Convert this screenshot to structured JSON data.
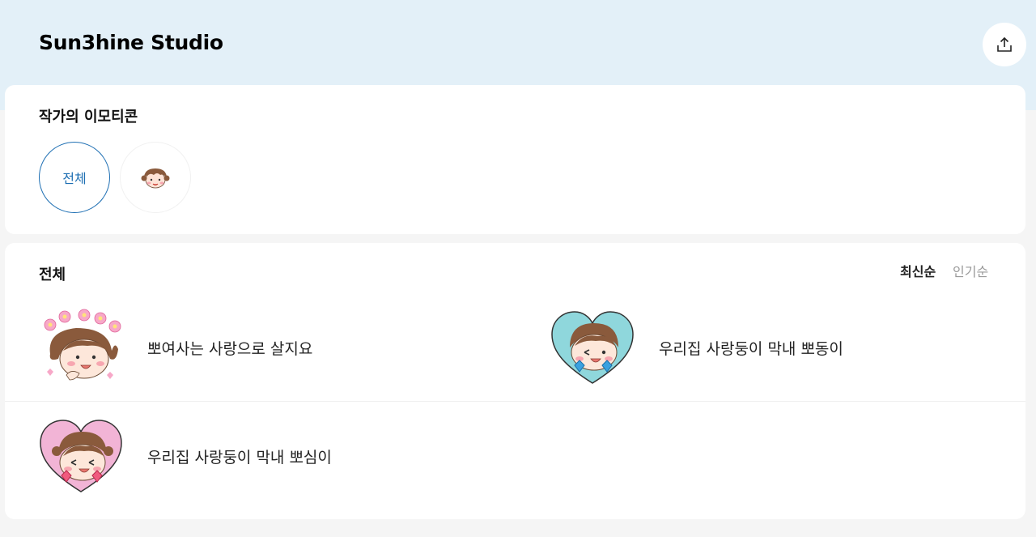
{
  "header": {
    "studio_name": "Sun3hine Studio",
    "share_icon": "share-upload-icon",
    "background_color": "#e3f0f8"
  },
  "artist_section": {
    "title": "작가의 이모티콘",
    "filters": [
      {
        "label": "전체",
        "selected": true
      },
      {
        "icon": "baby-face-emoticon-icon",
        "selected": false
      }
    ],
    "accent_color": "#1e6fb3"
  },
  "list_section": {
    "title": "전체",
    "sort_options": [
      {
        "label": "최신순",
        "active": true
      },
      {
        "label": "인기순",
        "active": false
      }
    ],
    "items": [
      {
        "title": "뽀여사는 사랑으로 살지요",
        "thumbnail": "baby-girl-flowers-icon"
      },
      {
        "title": "우리집 사랑둥이 막내 뽀동이",
        "thumbnail": "baby-boy-blue-heart-icon"
      },
      {
        "title": "우리집 사랑둥이 막내 뽀심이",
        "thumbnail": "baby-girl-pink-heart-icon"
      }
    ]
  }
}
